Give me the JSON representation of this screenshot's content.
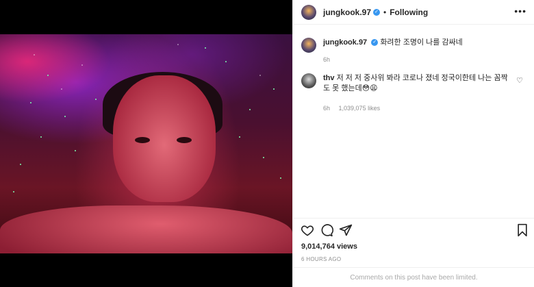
{
  "post": {
    "photo_alt": "photo"
  },
  "header": {
    "username": "jungkook.97",
    "separator": "•",
    "follow_status": "Following",
    "more_label": "•••"
  },
  "caption": {
    "username": "jungkook.97",
    "text": "화려한 조명이 나를 감싸네",
    "time": "6h"
  },
  "comments": [
    {
      "username": "thv",
      "text": "저 저 저 중사위 봐라 코로나 졌네 정국이한테 나는 꼼짝도 못 했는데😳😩",
      "time": "6h",
      "likes": "1,039,075 likes"
    }
  ],
  "stats": {
    "views": "9,014,764 views",
    "time_ago": "6 HOURS AGO"
  },
  "footer": {
    "comments_limited": "Comments on this post have been limited."
  },
  "icons": {
    "like": "heart-icon",
    "comment": "comment-icon",
    "share": "share-icon",
    "save": "bookmark-icon",
    "verified": "verified-badge-icon",
    "comment_like": "small-heart-icon"
  }
}
